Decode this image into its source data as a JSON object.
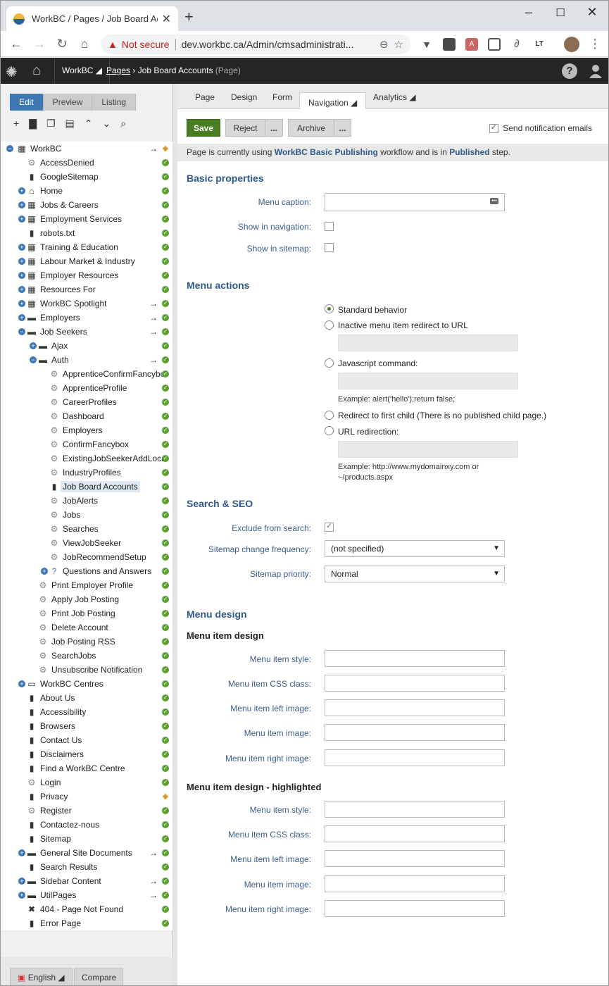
{
  "browser": {
    "tab_title": "WorkBC / Pages / Job Board Acc",
    "not_secure": "Not secure",
    "url": "dev.workbc.ca/Admin/cmsadministrati..."
  },
  "header": {
    "site": "WorkBC",
    "breadcrumb_root": "Pages",
    "breadcrumb_page": "Job Board Accounts",
    "breadcrumb_type": "(Page)"
  },
  "left": {
    "modes": [
      "Edit",
      "Preview",
      "Listing"
    ],
    "language": "English",
    "compare": "Compare",
    "tree": [
      {
        "label": "WorkBC",
        "lvl": 0,
        "exp": "-",
        "ico": "▦",
        "arr": true,
        "st": "dia"
      },
      {
        "label": "AccessDenied",
        "lvl": 1,
        "ico": "⚙",
        "st": "ok"
      },
      {
        "label": "GoogleSitemap",
        "lvl": 1,
        "ico": "▮",
        "st": "ok"
      },
      {
        "label": "Home",
        "lvl": 1,
        "exp": "+",
        "ico": "⌂",
        "st": "ok"
      },
      {
        "label": "Jobs & Careers",
        "lvl": 1,
        "exp": "+",
        "ico": "▦",
        "st": "ok"
      },
      {
        "label": "Employment Services",
        "lvl": 1,
        "exp": "+",
        "ico": "▦",
        "st": "ok"
      },
      {
        "label": "robots.txt",
        "lvl": 1,
        "ico": "▮",
        "st": "ok"
      },
      {
        "label": "Training & Education",
        "lvl": 1,
        "exp": "+",
        "ico": "▦",
        "st": "ok"
      },
      {
        "label": "Labour Market & Industry",
        "lvl": 1,
        "exp": "+",
        "ico": "▦",
        "st": "ok"
      },
      {
        "label": "Employer Resources",
        "lvl": 1,
        "exp": "+",
        "ico": "▦",
        "st": "ok"
      },
      {
        "label": "Resources For",
        "lvl": 1,
        "exp": "+",
        "ico": "▦",
        "st": "ok"
      },
      {
        "label": "WorkBC Spotlight",
        "lvl": 1,
        "exp": "+",
        "ico": "▦",
        "arr": true,
        "st": "ok"
      },
      {
        "label": "Employers",
        "lvl": 1,
        "exp": "+",
        "ico": "▬",
        "arr": true,
        "st": "ok"
      },
      {
        "label": "Job Seekers",
        "lvl": 1,
        "exp": "-",
        "ico": "▬",
        "arr": true,
        "st": "ok"
      },
      {
        "label": "Ajax",
        "lvl": 2,
        "exp": "+",
        "ico": "▬",
        "st": "ok"
      },
      {
        "label": "Auth",
        "lvl": 2,
        "exp": "-",
        "ico": "▬",
        "arr": true,
        "st": "ok"
      },
      {
        "label": "ApprenticeConfirmFancybc",
        "lvl": 3,
        "ico": "⚙",
        "st": "ok"
      },
      {
        "label": "ApprenticeProfile",
        "lvl": 3,
        "ico": "⚙",
        "st": "ok"
      },
      {
        "label": "CareerProfiles",
        "lvl": 3,
        "ico": "⚙",
        "st": "ok"
      },
      {
        "label": "Dashboard",
        "lvl": 3,
        "ico": "⚙",
        "st": "ok"
      },
      {
        "label": "Employers",
        "lvl": 3,
        "ico": "⚙",
        "st": "ok"
      },
      {
        "label": "ConfirmFancybox",
        "lvl": 3,
        "ico": "⚙",
        "st": "ok"
      },
      {
        "label": "ExistingJobSeekerAddLoca",
        "lvl": 3,
        "ico": "⚙",
        "st": "ok"
      },
      {
        "label": "IndustryProfiles",
        "lvl": 3,
        "ico": "⚙",
        "st": "ok"
      },
      {
        "label": "Job Board Accounts",
        "lvl": 3,
        "ico": "▮",
        "st": "ok",
        "sel": true
      },
      {
        "label": "JobAlerts",
        "lvl": 3,
        "ico": "⚙",
        "st": "ok"
      },
      {
        "label": "Jobs",
        "lvl": 3,
        "ico": "⚙",
        "st": "ok"
      },
      {
        "label": "Searches",
        "lvl": 3,
        "ico": "⚙",
        "st": "ok"
      },
      {
        "label": "ViewJobSeeker",
        "lvl": 3,
        "ico": "⚙",
        "st": "ok"
      },
      {
        "label": "JobRecommendSetup",
        "lvl": 3,
        "ico": "⚙",
        "st": "ok"
      },
      {
        "label": "Questions and Answers",
        "lvl": 3,
        "exp": "+",
        "ico": "?",
        "st": "ok"
      },
      {
        "label": "Print Employer Profile",
        "lvl": 2,
        "ico": "⚙",
        "st": "ok"
      },
      {
        "label": "Apply Job Posting",
        "lvl": 2,
        "ico": "⚙",
        "st": "ok"
      },
      {
        "label": "Print Job Posting",
        "lvl": 2,
        "ico": "⚙",
        "st": "ok"
      },
      {
        "label": "Delete Account",
        "lvl": 2,
        "ico": "⚙",
        "st": "ok"
      },
      {
        "label": "Job Posting RSS",
        "lvl": 2,
        "ico": "⚙",
        "st": "ok"
      },
      {
        "label": "SearchJobs",
        "lvl": 2,
        "ico": "⚙",
        "st": "ok"
      },
      {
        "label": "Unsubscribe Notification",
        "lvl": 2,
        "ico": "⚙",
        "st": "ok"
      },
      {
        "label": "WorkBC Centres",
        "lvl": 1,
        "exp": "+",
        "ico": "▭",
        "st": "ok"
      },
      {
        "label": "About Us",
        "lvl": 1,
        "ico": "▮",
        "st": "ok"
      },
      {
        "label": "Accessibility",
        "lvl": 1,
        "ico": "▮",
        "st": "ok"
      },
      {
        "label": "Browsers",
        "lvl": 1,
        "ico": "▮",
        "st": "ok"
      },
      {
        "label": "Contact Us",
        "lvl": 1,
        "ico": "▮",
        "st": "ok"
      },
      {
        "label": "Disclaimers",
        "lvl": 1,
        "ico": "▮",
        "st": "ok"
      },
      {
        "label": "Find a WorkBC Centre",
        "lvl": 1,
        "ico": "▮",
        "st": "ok"
      },
      {
        "label": "Login",
        "lvl": 1,
        "ico": "⚙",
        "st": "ok"
      },
      {
        "label": "Privacy",
        "lvl": 1,
        "ico": "▮",
        "st": "dia"
      },
      {
        "label": "Register",
        "lvl": 1,
        "ico": "⚙",
        "st": "ok"
      },
      {
        "label": "Contactez-nous",
        "lvl": 1,
        "ico": "▮",
        "st": "ok"
      },
      {
        "label": "Sitemap",
        "lvl": 1,
        "ico": "▮",
        "st": "ok"
      },
      {
        "label": "General Site Documents",
        "lvl": 1,
        "exp": "+",
        "ico": "▬",
        "arr": true,
        "st": "ok"
      },
      {
        "label": "Search Results",
        "lvl": 1,
        "ico": "▮",
        "st": "ok"
      },
      {
        "label": "Sidebar Content",
        "lvl": 1,
        "exp": "+",
        "ico": "▬",
        "arr": true,
        "st": "ok"
      },
      {
        "label": "UtilPages",
        "lvl": 1,
        "exp": "+",
        "ico": "▬",
        "arr": true,
        "st": "ok"
      },
      {
        "label": "404 - Page Not Found",
        "lvl": 1,
        "ico": "✖",
        "st": "ok"
      },
      {
        "label": "Error Page",
        "lvl": 1,
        "ico": "▮",
        "st": "ok"
      }
    ]
  },
  "right": {
    "tabs": [
      "Page",
      "Design",
      "Form",
      "Navigation",
      "Analytics"
    ],
    "save": "Save",
    "reject": "Reject",
    "archive": "Archive",
    "more": "...",
    "send_notification": "Send notification emails",
    "workflow": {
      "pre": "Page is currently using ",
      "name": "WorkBC Basic Publishing",
      "mid": " workflow and is in ",
      "step": "Published",
      "post": " step."
    },
    "basic": {
      "title": "Basic properties",
      "menu_caption": "Menu caption:",
      "show_nav": "Show in navigation:",
      "show_sitemap": "Show in sitemap:"
    },
    "menu_actions": {
      "title": "Menu actions",
      "standard": "Standard behavior",
      "inactive": "Inactive menu item redirect to URL",
      "javascript": "Javascript command:",
      "js_example": "Example: alert('hello');return false;",
      "first_child": "Redirect to first child (There is no published child page.)",
      "url_redirect": "URL redirection:",
      "url_example_1": "Example: http://www.mydomainxy.com or",
      "url_example_2": "~/products.aspx"
    },
    "seo": {
      "title": "Search & SEO",
      "exclude": "Exclude from search:",
      "freq": "Sitemap change frequency:",
      "freq_value": "(not specified)",
      "priority": "Sitemap priority:",
      "priority_value": "Normal"
    },
    "design": {
      "title": "Menu design",
      "item_title": "Menu item design",
      "highlight_title": "Menu item design - highlighted",
      "style": "Menu item style:",
      "css": "Menu item CSS class:",
      "left_image": "Menu item left image:",
      "image": "Menu item image:",
      "right_image": "Menu item right image:"
    }
  }
}
